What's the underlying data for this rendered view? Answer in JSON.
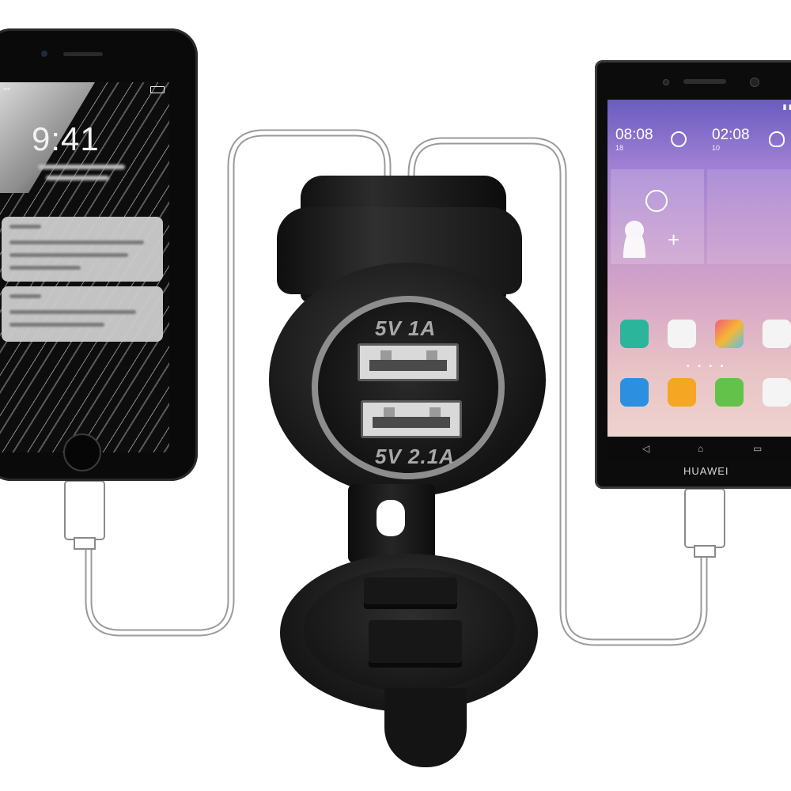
{
  "left_phone": {
    "clock": "9:41"
  },
  "right_phone": {
    "brand": "HUAWEI",
    "time_1": "08:08",
    "time_2": "02:08",
    "day_1": "18",
    "day_2": "10"
  },
  "charger": {
    "port_top_label": "5V 1A",
    "port_bottom_label": "5V 2.1A"
  },
  "colors": {
    "background": "#ffffff",
    "charger_body": "#1a1a1a",
    "charger_ring": "#8d8d8d",
    "cable": "#ffffff"
  }
}
